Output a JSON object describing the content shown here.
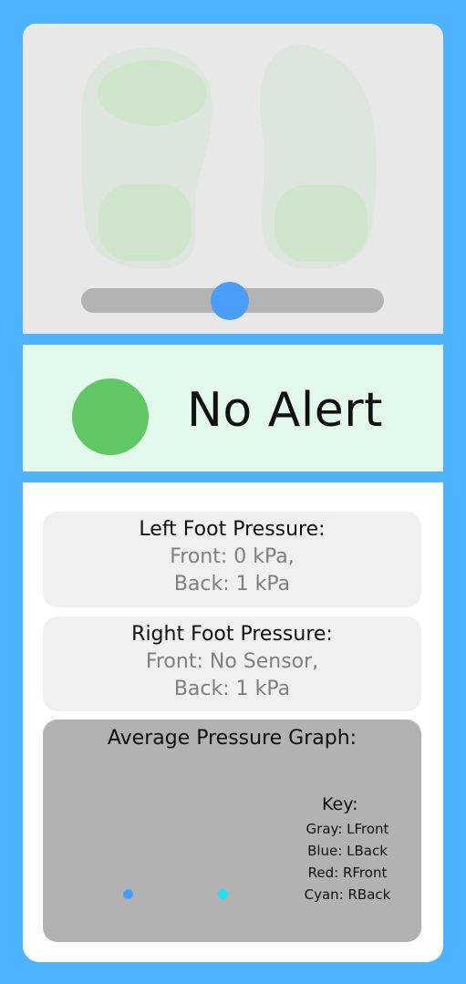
{
  "foot_map": {
    "slider_value_percent": 49,
    "colors": {
      "background": "#e8e8e8",
      "foot_outline": "#dde6dd",
      "pressure_zone": "#cfe5cc",
      "slider_track": "#b3b3b3",
      "slider_thumb": "#4a9ef7"
    }
  },
  "alert": {
    "text": "No Alert",
    "indicator_color": "#61c765",
    "background": "#e3f9ec"
  },
  "left_foot": {
    "title": "Left Foot Pressure:",
    "front": "Front: 0 kPa,",
    "back": "Back: 1 kPa"
  },
  "right_foot": {
    "title": "Right Foot Pressure:",
    "front": "Front: No Sensor,",
    "back": "Back: 1 kPa"
  },
  "graph": {
    "title": "Average Pressure Graph:",
    "key_title": "Key:",
    "key_items": [
      "Gray: LFront",
      "Blue: LBack",
      "Red: RFront",
      "Cyan: RBack"
    ],
    "series_colors": {
      "LFront": "#888888",
      "LBack": "#4a9ef7",
      "RFront": "#e53935",
      "RBack": "#22e0f0"
    },
    "points": [
      {
        "series": "LBack",
        "color": "#4a9ef7",
        "slot": 1
      },
      {
        "series": "RBack",
        "color": "#22e0f0",
        "slot": 2
      }
    ]
  }
}
